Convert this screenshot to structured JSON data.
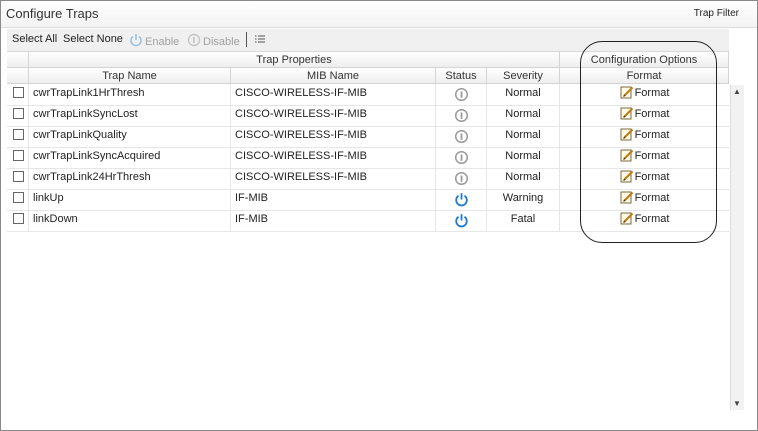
{
  "header": {
    "title": "Configure Traps",
    "trap_filter": "Trap Filter"
  },
  "toolbar": {
    "select_all": "Select All",
    "select_none": "Select None",
    "enable": "Enable",
    "disable": "Disable",
    "icons": {
      "enable": "power-icon",
      "disable": "status-icon",
      "columns": "list-menu-icon"
    }
  },
  "columns": {
    "group_trap_properties": "Trap Properties",
    "group_configuration_options": "Configuration Options",
    "trap_name": "Trap Name",
    "mib_name": "MIB Name",
    "status": "Status",
    "severity": "Severity",
    "format": "Format"
  },
  "rows": [
    {
      "trap_name": "cwrTrapLink1HrThresh",
      "mib_name": "CISCO-WIRELESS-IF-MIB",
      "status": "disabled",
      "severity": "Normal",
      "format": "Format"
    },
    {
      "trap_name": "cwrTrapLinkSyncLost",
      "mib_name": "CISCO-WIRELESS-IF-MIB",
      "status": "disabled",
      "severity": "Normal",
      "format": "Format"
    },
    {
      "trap_name": "cwrTrapLinkQuality",
      "mib_name": "CISCO-WIRELESS-IF-MIB",
      "status": "disabled",
      "severity": "Normal",
      "format": "Format"
    },
    {
      "trap_name": "cwrTrapLinkSyncAcquired",
      "mib_name": "CISCO-WIRELESS-IF-MIB",
      "status": "disabled",
      "severity": "Normal",
      "format": "Format"
    },
    {
      "trap_name": "cwrTrapLink24HrThresh",
      "mib_name": "CISCO-WIRELESS-IF-MIB",
      "status": "disabled",
      "severity": "Normal",
      "format": "Format"
    },
    {
      "trap_name": "linkUp",
      "mib_name": "IF-MIB",
      "status": "enabled",
      "severity": "Warning",
      "format": "Format"
    },
    {
      "trap_name": "linkDown",
      "mib_name": "IF-MIB",
      "status": "enabled",
      "severity": "Fatal",
      "format": "Format"
    }
  ],
  "colors": {
    "enabled_status": "#1a7bd0",
    "disabled_status": "#9a9a9a",
    "toolbar_disabled_text": "#a0a0a0",
    "annotation_border": "#222222"
  }
}
